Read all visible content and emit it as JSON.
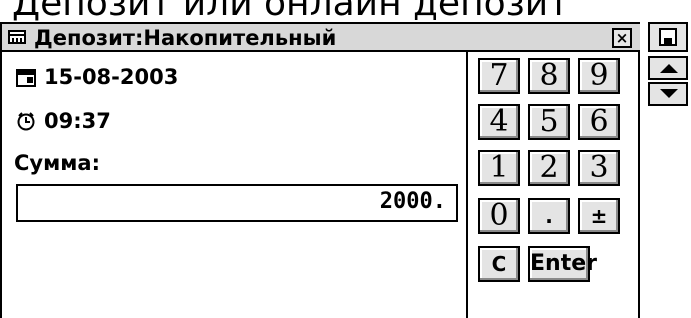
{
  "heading": "Депозит или онлайн депозит",
  "window": {
    "title": "Депозит:Накопительный",
    "close_label": "×"
  },
  "fields": {
    "date": "15-08-2003",
    "time": "09:37",
    "sum_label": "Сумма:",
    "sum_value": "2000."
  },
  "keypad": {
    "keys": [
      "7",
      "8",
      "9",
      "4",
      "5",
      "6",
      "1",
      "2",
      "3",
      "0",
      ".",
      "±",
      "C",
      "Enter"
    ]
  },
  "side": {
    "icons": [
      "save-icon",
      "scroll-up-icon",
      "scroll-down-icon"
    ]
  },
  "icons": {
    "title": "window-menu-icon",
    "date": "calendar-icon",
    "time": "alarm-clock-icon"
  }
}
